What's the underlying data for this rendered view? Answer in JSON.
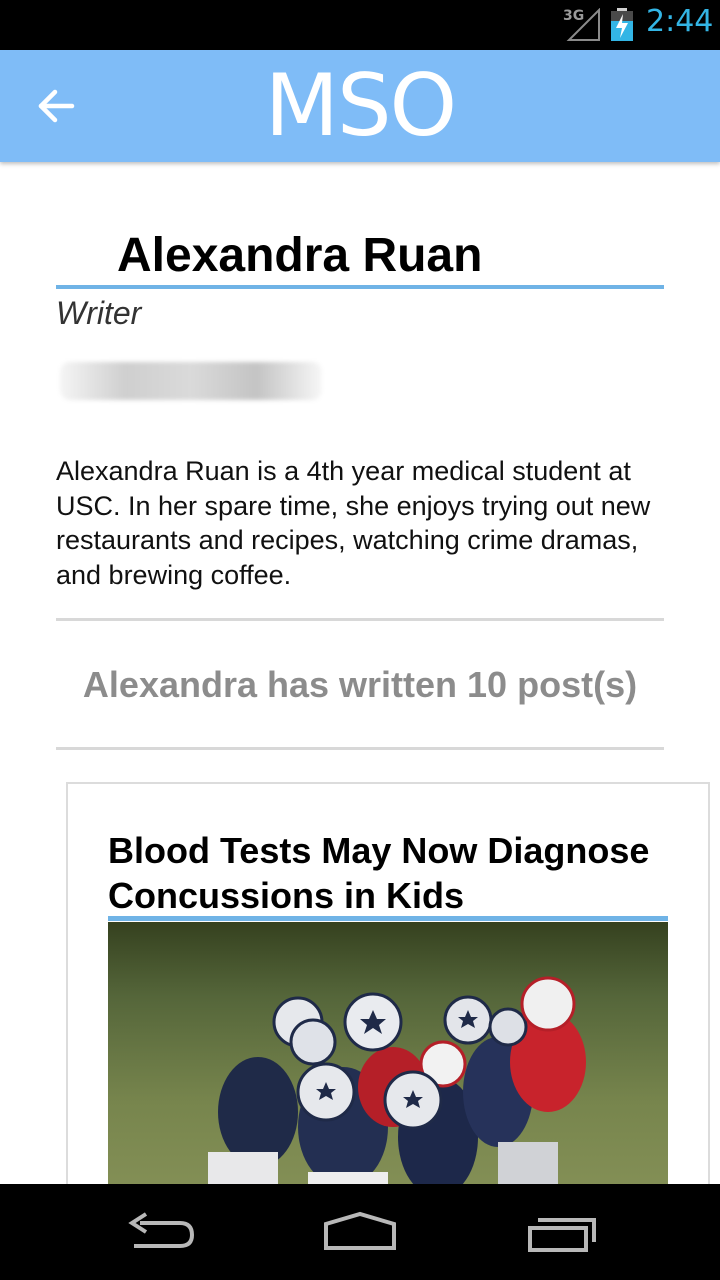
{
  "status_bar": {
    "network": "3G",
    "time": "2:44",
    "icons": [
      "signal-icon",
      "battery-charging-icon"
    ]
  },
  "app_bar": {
    "logo": "MSO",
    "back_icon": "arrow-left-icon",
    "color": "#7fbcf7"
  },
  "author": {
    "name": "Alexandra Ruan",
    "role": "Writer",
    "email": "",
    "bio": "Alexandra Ruan is a 4th year medical student at USC. In her spare time, she enjoys trying out new restaurants and recipes, watching crime dramas, and brewing coffee."
  },
  "posts_summary": "Alexandra has written 10 post(s)",
  "posts": [
    {
      "title": "Blood Tests May Now Diagnose Concussions in Kids",
      "image_icon": "football-photo"
    }
  ],
  "nav_bar": {
    "icons": [
      "back-nav-icon",
      "home-nav-icon",
      "recent-apps-icon"
    ]
  },
  "colors": {
    "accent": "#6fb3e6",
    "status_clock": "#33b5e5",
    "muted_text": "#8c8c8c"
  }
}
